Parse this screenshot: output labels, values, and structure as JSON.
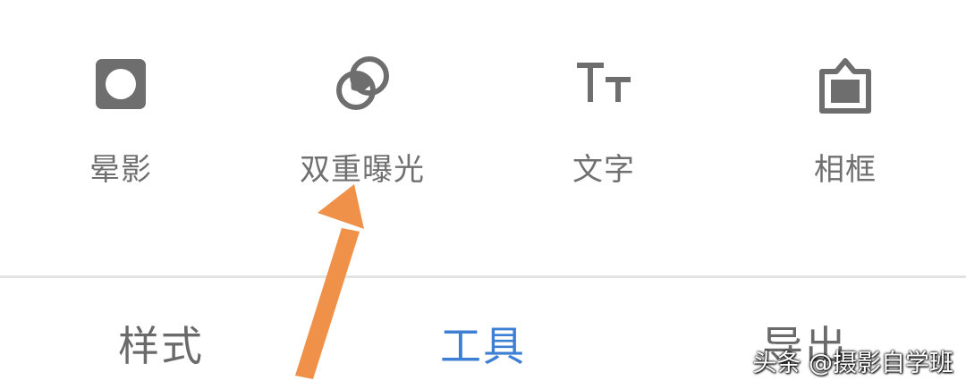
{
  "tools": [
    {
      "label": "晕影",
      "icon": "vignette-icon"
    },
    {
      "label": "双重曝光",
      "icon": "double-exposure-icon"
    },
    {
      "label": "文字",
      "icon": "text-icon"
    },
    {
      "label": "相框",
      "icon": "frame-icon"
    }
  ],
  "tabs": [
    {
      "label": "样式",
      "active": false
    },
    {
      "label": "工具",
      "active": true
    },
    {
      "label": "导出",
      "active": false
    }
  ],
  "watermark": "头条 @摄影自学班",
  "colors": {
    "icon": "#6e6e6e",
    "label": "#707070",
    "active_tab": "#3d7fd4",
    "inactive_tab": "#6a6a6a",
    "arrow": "#f0914a",
    "divider": "#e3e3e3"
  }
}
